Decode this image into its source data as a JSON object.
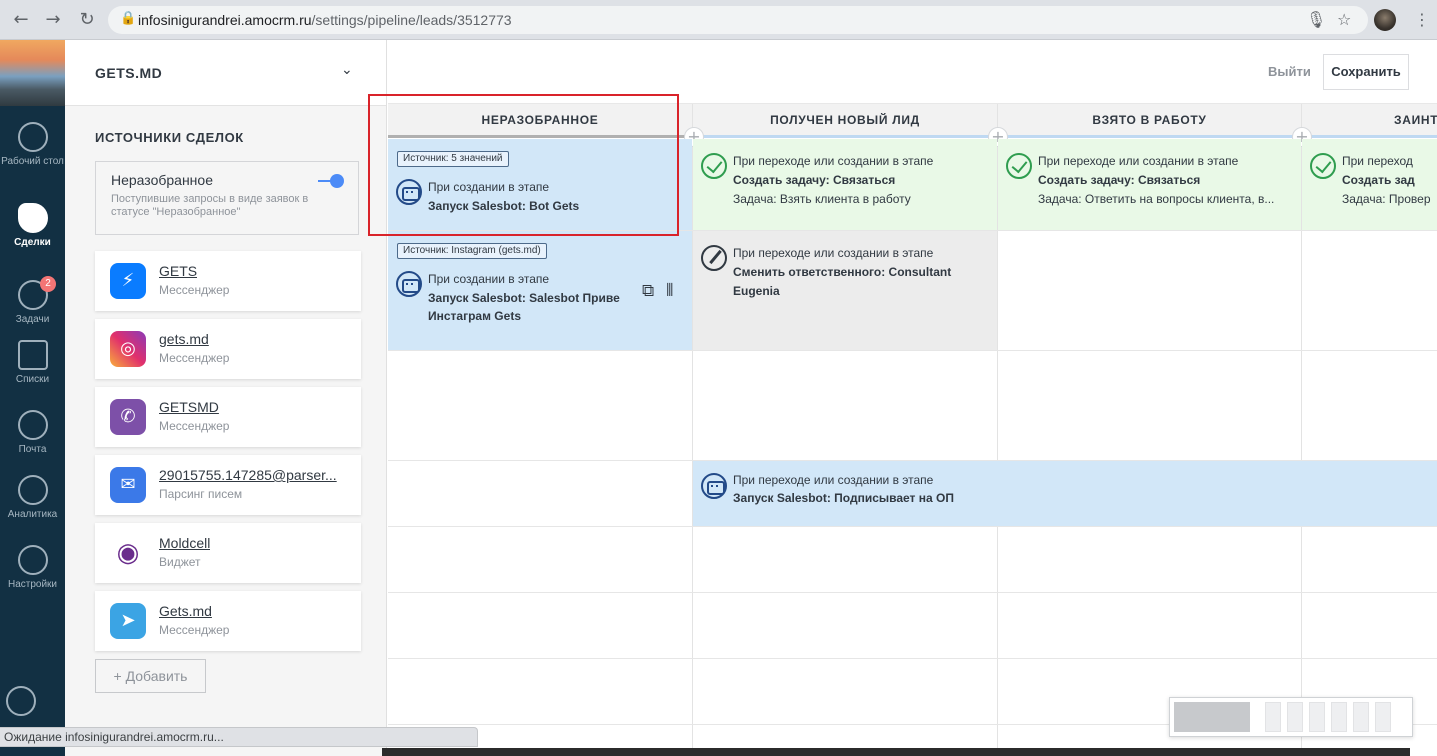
{
  "browser": {
    "url_host": "infosinigurandrei.amocrm.ru",
    "url_path": "/settings/pipeline/leads/3512773",
    "back_glyph": "←",
    "forward_glyph": "→",
    "reload_glyph": "↻",
    "lock_glyph": "🔒",
    "mic_glyph": "🎙",
    "star_glyph": "☆",
    "menu_glyph": "⋮"
  },
  "sidebar": {
    "items": [
      {
        "label": "Рабочий стол",
        "icon": "speedometer-icon"
      },
      {
        "label": "Сделки",
        "icon": "dollar-icon"
      },
      {
        "label": "Задачи",
        "icon": "check-circle-icon",
        "badge": "2"
      },
      {
        "label": "Списки",
        "icon": "list-icon"
      },
      {
        "label": "Почта",
        "icon": "mail-icon"
      },
      {
        "label": "Аналитика",
        "icon": "analytics-icon"
      },
      {
        "label": "Настройки",
        "icon": "wrench-icon"
      }
    ]
  },
  "settings": {
    "pipeline_name": "GETS.MD",
    "chevron": "⌄",
    "sources_title": "ИСТОЧНИКИ СДЕЛОК",
    "unsorted": {
      "title": "Неразобранное",
      "description": "Поступившие запросы в виде заявок в статусе \"Неразобранное\""
    },
    "sources": [
      {
        "name": "GETS",
        "type": "Мессенджер",
        "icon": "messenger-icon",
        "color": "#0a7cff",
        "glyph": "⚡"
      },
      {
        "name": "gets.md",
        "type": "Мессенджер",
        "icon": "instagram-icon",
        "color": "#d62e7e",
        "glyph": "◎"
      },
      {
        "name": "GETSMD",
        "type": "Мессенджер",
        "icon": "viber-icon",
        "color": "#7d50a8",
        "glyph": "✆"
      },
      {
        "name": "29015755.147285@parser...",
        "type": "Парсинг писем",
        "icon": "mail-icon",
        "color": "#3b79e8",
        "glyph": "✉"
      },
      {
        "name": "Moldcell",
        "type": "Виджет",
        "icon": "moldcell-icon",
        "color": "#ffffff",
        "glyph": "◉"
      },
      {
        "name": "Gets.md",
        "type": "Мессенджер",
        "icon": "telegram-icon",
        "color": "#3ba4e4",
        "glyph": "➤"
      }
    ],
    "add_label": "+ Добавить"
  },
  "main": {
    "logout_label": "Выйти",
    "save_label": "Сохранить",
    "stages": [
      {
        "title": "НЕРАЗОБРАННОЕ"
      },
      {
        "title": "ПОЛУЧЕН НОВЫЙ ЛИД"
      },
      {
        "title": "ВЗЯТО В РАБОТУ"
      },
      {
        "title": "ЗАИНТ"
      }
    ],
    "cells": {
      "c0_r0": {
        "source": "Источник: 5 значений",
        "line1": "При создании в этапе",
        "line2": "Запуск Salesbot: Bot Gets"
      },
      "c0_r1": {
        "source": "Источник: Instagram (gets.md)",
        "line1": "При создании в этапе",
        "line2": "Запуск Salesbot: Salesbot Приве",
        "line3": "Инстаграм Gets"
      },
      "c1_r0": {
        "line1": "При переходе или создании в этапе",
        "line2": "Создать задачу: Связаться",
        "line3": "Задача: Взять клиента в работу"
      },
      "c2_r0": {
        "line1": "При переходе или создании в этапе",
        "line2": "Создать задачу: Связаться",
        "line3": "Задача: Ответить на вопросы клиента, в..."
      },
      "c3_r0": {
        "line1": "При переход",
        "line2": "Создать зад",
        "line3": "Задача: Провер"
      },
      "c1_r1": {
        "line1": "При переходе или создании в этапе",
        "line2": "Сменить ответственного: Consultant",
        "line3": "Eugenia"
      },
      "wide_r3": {
        "line1": "При переходе или создании в этапе",
        "line2": "Запуск Salesbot: Подписывает на ОП"
      }
    },
    "copy_glyph": "⧉",
    "drag_glyph": "⦀",
    "plus_glyph": "+"
  },
  "status_bar": {
    "text": "Ожидание infosinigurandrei.amocrm.ru..."
  }
}
